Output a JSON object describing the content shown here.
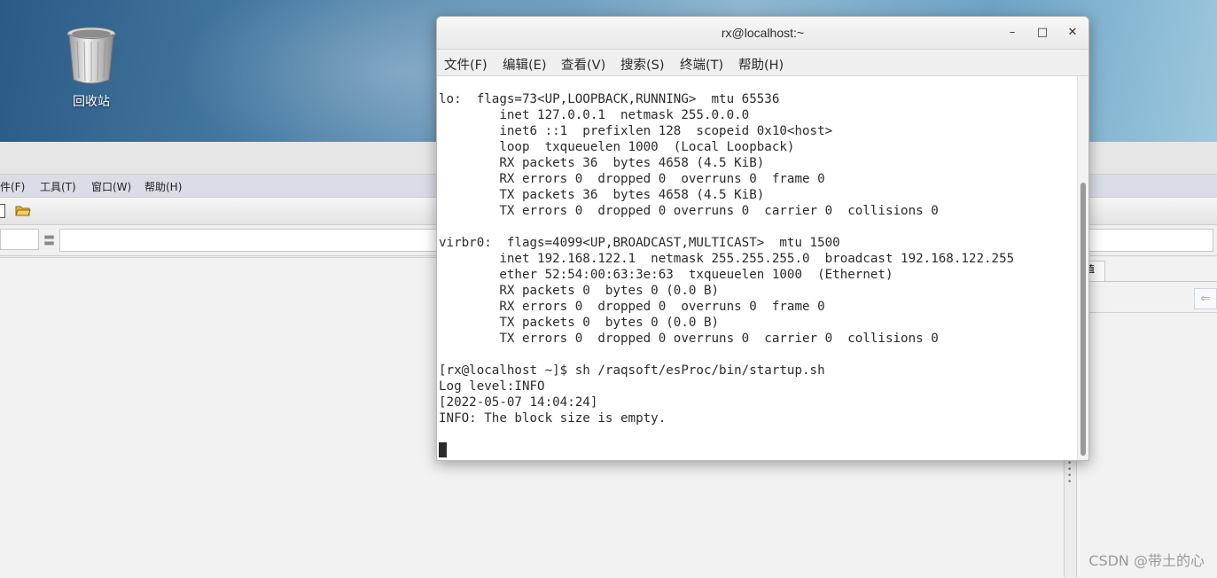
{
  "desktop": {
    "trash_label": "回收站"
  },
  "bg_app": {
    "menu": [
      "件(F)",
      "工具(T)",
      "窗口(W)",
      "帮助(H)"
    ],
    "side_tab_label": "值",
    "back_button_glyph": "⇐"
  },
  "terminal": {
    "title": "rx@localhost:~",
    "controls": {
      "minimize": "–",
      "maximize": "□",
      "close": "✕"
    },
    "menu": [
      "文件(F)",
      "编辑(E)",
      "查看(V)",
      "搜索(S)",
      "终端(T)",
      "帮助(H)"
    ],
    "lines": [
      "lo:  flags=73<UP,LOOPBACK,RUNNING>  mtu 65536",
      "        inet 127.0.0.1  netmask 255.0.0.0",
      "        inet6 ::1  prefixlen 128  scopeid 0x10<host>",
      "        loop  txqueuelen 1000  (Local Loopback)",
      "        RX packets 36  bytes 4658 (4.5 KiB)",
      "        RX errors 0  dropped 0  overruns 0  frame 0",
      "        TX packets 36  bytes 4658 (4.5 KiB)",
      "        TX errors 0  dropped 0 overruns 0  carrier 0  collisions 0",
      "",
      "virbr0:  flags=4099<UP,BROADCAST,MULTICAST>  mtu 1500",
      "        inet 192.168.122.1  netmask 255.255.255.0  broadcast 192.168.122.255",
      "        ether 52:54:00:63:3e:63  txqueuelen 1000  (Ethernet)",
      "        RX packets 0  bytes 0 (0.0 B)",
      "        RX errors 0  dropped 0  overruns 0  frame 0",
      "        TX packets 0  bytes 0 (0.0 B)",
      "        TX errors 0  dropped 0 overruns 0  carrier 0  collisions 0",
      "",
      "[rx@localhost ~]$ sh /raqsoft/esProc/bin/startup.sh",
      "Log level:INFO",
      "[2022-05-07 14:04:24]",
      "INFO: The block size is empty."
    ]
  },
  "watermark": "CSDN @带土的心",
  "colors": {
    "terminal_bg": "#ffffff",
    "terminal_text": "#2b2b2b",
    "menubar_bg": "#d9dee6"
  }
}
